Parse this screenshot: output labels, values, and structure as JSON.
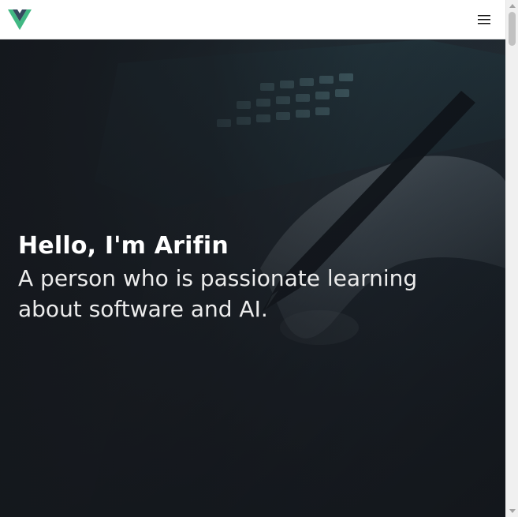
{
  "header": {
    "logo_icon": "vue-logo-icon",
    "menu_icon": "hamburger-menu-icon"
  },
  "hero": {
    "title": "Hello, I'm Arifin",
    "subtitle": "A person who is passionate learning about software and AI."
  },
  "colors": {
    "logo_outer": "#41b883",
    "logo_inner": "#35495e",
    "hero_background": "#1b1f24",
    "navbar_background": "#ffffff"
  }
}
